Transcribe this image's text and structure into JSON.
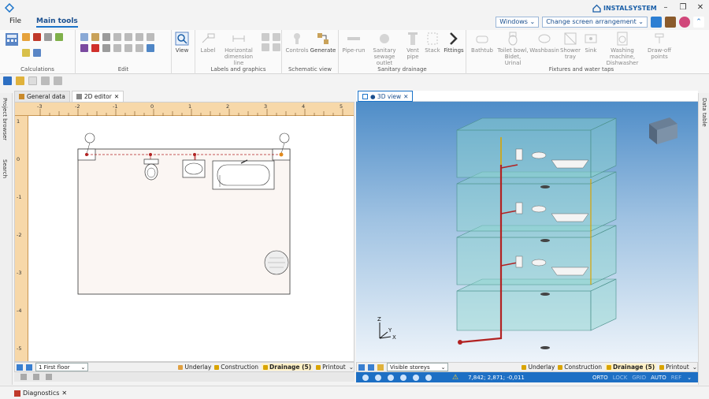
{
  "app": {
    "brand": "INSTALSYSTEM"
  },
  "menu": {
    "file": "File",
    "main_tools": "Main tools"
  },
  "topright": {
    "windows": "Windows ⌄",
    "arrangement": "Change screen arrangement ⌄"
  },
  "ribbon": {
    "groups": {
      "calculations": "Calculations",
      "edit": "Edit",
      "labels": "Labels and graphics",
      "schematic": "Schematic view",
      "sanitary": "Sanitary drainage",
      "fixtures": "Fixtures and water taps"
    },
    "buttons": {
      "view": "View",
      "label": "Label",
      "horizontal_dim": "Horizontal dimension line",
      "controls": "Controls",
      "generate": "Generate",
      "pipe_run": "Pipe-run",
      "sanitary_outlet": "Sanitary sewage outlet",
      "vent_pipe": "Vent pipe",
      "stack": "Stack",
      "fittings": "Fittings",
      "bathtub": "Bathtub",
      "toilet": "Toilet bowl, Bidet, Urinal",
      "washbasin": "Washbasin",
      "shower": "Shower tray",
      "sink": "Sink",
      "washing": "Washing machine, Dishwasher",
      "drawoff": "Draw-off points"
    }
  },
  "side": {
    "project_browser": "Project browser",
    "search": "Search",
    "data_table": "Data table"
  },
  "tabs": {
    "general_data": "General data",
    "editor_2d": "2D editor",
    "view_3d": "● 3D view"
  },
  "ruler": {
    "h_ticks": [
      "-3",
      "-2",
      "-1",
      "0",
      "1",
      "2",
      "3",
      "4",
      "5"
    ],
    "v_ticks": [
      "1",
      "0",
      "-1",
      "-2",
      "-3",
      "-4",
      "-5"
    ]
  },
  "status_left": {
    "floor": "1 First floor",
    "layers": [
      "Underlay",
      "Construction",
      "Drainage (5)",
      "Printout"
    ]
  },
  "status_right": {
    "visible": "Visible storeys",
    "layers": [
      "Underlay",
      "Construction",
      "Drainage (5)",
      "Printout"
    ],
    "coords": "7,842; 2,871; -0,011",
    "modes": [
      "ORTO",
      "LOCK",
      "GRID",
      "AUTO",
      "REF"
    ]
  },
  "diagnostics": "Diagnostics",
  "colors": {
    "accent": "#1a73c9",
    "ruler": "#f7d8a9",
    "pipe": "#b22222",
    "vent": "#d9a400"
  }
}
